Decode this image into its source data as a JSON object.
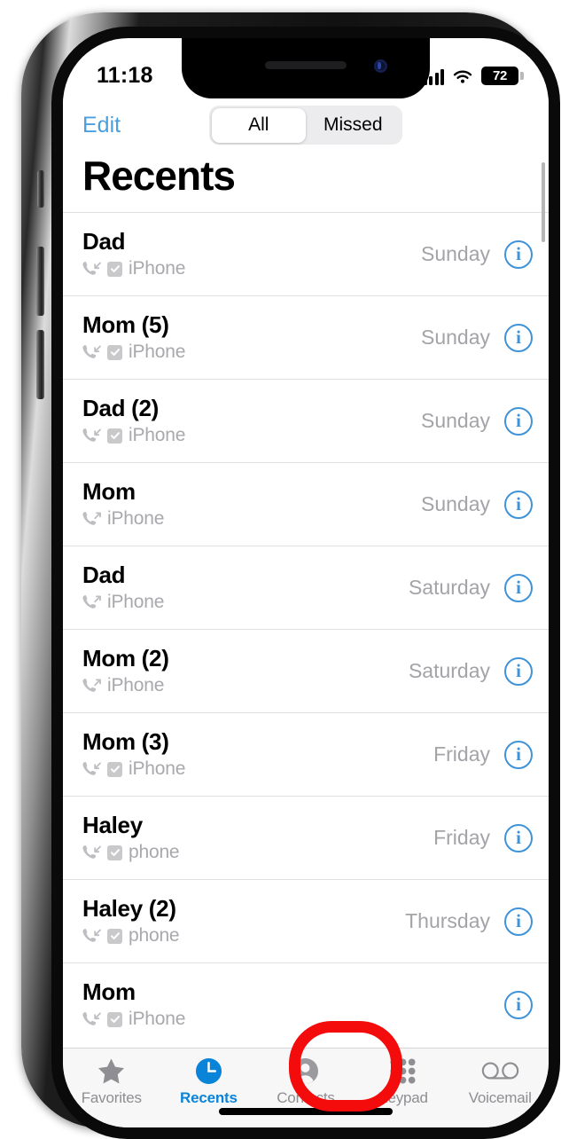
{
  "status_bar": {
    "time": "11:18",
    "signal_icon": "cellular-signal-icon",
    "wifi_icon": "wifi-icon",
    "battery_level": "72"
  },
  "nav": {
    "edit_label": "Edit",
    "segments": [
      {
        "label": "All",
        "selected": true
      },
      {
        "label": "Missed",
        "selected": false
      }
    ]
  },
  "title": "Recents",
  "calls": [
    {
      "name": "Dad",
      "direction": "incoming",
      "sim_badge": true,
      "label": "iPhone",
      "time": "Sunday",
      "info": "i"
    },
    {
      "name": "Mom (5)",
      "direction": "incoming",
      "sim_badge": true,
      "label": "iPhone",
      "time": "Sunday",
      "info": "i"
    },
    {
      "name": "Dad (2)",
      "direction": "incoming",
      "sim_badge": true,
      "label": "iPhone",
      "time": "Sunday",
      "info": "i"
    },
    {
      "name": "Mom",
      "direction": "outgoing",
      "sim_badge": false,
      "label": "iPhone",
      "time": "Sunday",
      "info": "i"
    },
    {
      "name": "Dad",
      "direction": "outgoing",
      "sim_badge": false,
      "label": "iPhone",
      "time": "Saturday",
      "info": "i"
    },
    {
      "name": "Mom (2)",
      "direction": "outgoing",
      "sim_badge": false,
      "label": "iPhone",
      "time": "Saturday",
      "info": "i"
    },
    {
      "name": "Mom (3)",
      "direction": "incoming",
      "sim_badge": true,
      "label": "iPhone",
      "time": "Friday",
      "info": "i"
    },
    {
      "name": "Haley",
      "direction": "incoming",
      "sim_badge": true,
      "label": "phone",
      "time": "Friday",
      "info": "i"
    },
    {
      "name": "Haley (2)",
      "direction": "incoming",
      "sim_badge": true,
      "label": "phone",
      "time": "Thursday",
      "info": "i"
    },
    {
      "name": "Mom",
      "direction": "incoming",
      "sim_badge": true,
      "label": "iPhone",
      "time": "",
      "info": "i"
    }
  ],
  "tabs": [
    {
      "label": "Favorites",
      "icon": "star-icon",
      "active": false
    },
    {
      "label": "Recents",
      "icon": "clock-icon",
      "active": true
    },
    {
      "label": "Contacts",
      "icon": "person-icon",
      "active": false
    },
    {
      "label": "Keypad",
      "icon": "keypad-icon",
      "active": false
    },
    {
      "label": "Voicemail",
      "icon": "voicemail-icon",
      "active": false
    }
  ],
  "annotation": {
    "target": "Contacts",
    "color": "#f40b0b"
  },
  "colors": {
    "accent_blue": "#0a84d8",
    "link_blue": "#4a9fe0",
    "info_blue": "#3f93d8",
    "secondary_text": "#a8a8ad",
    "annotation_red": "#f40b0b"
  }
}
